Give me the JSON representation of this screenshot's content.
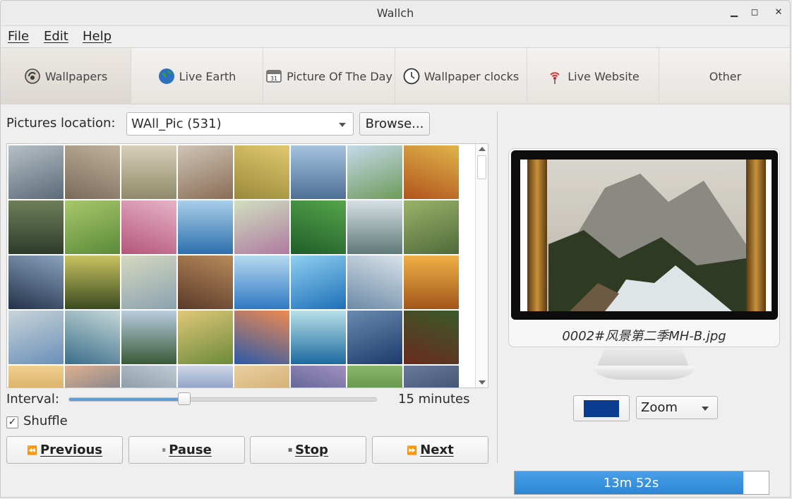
{
  "window": {
    "title": "Wallch"
  },
  "menu": [
    {
      "label": "File",
      "icon": "file"
    },
    {
      "label": "Edit",
      "icon": "edit"
    },
    {
      "label": "Help",
      "icon": "help"
    }
  ],
  "tabs": [
    {
      "label": "Wallpapers",
      "icon": "wallpapers-icon",
      "active": true
    },
    {
      "label": "Live Earth",
      "icon": "globe-icon",
      "active": false
    },
    {
      "label": "Picture Of The Day",
      "icon": "calendar-icon",
      "active": false
    },
    {
      "label": "Wallpaper clocks",
      "icon": "clock-icon",
      "active": false
    },
    {
      "label": "Live Website",
      "icon": "broadcast-icon",
      "active": false
    },
    {
      "label": "Other",
      "icon": "",
      "active": false
    }
  ],
  "location": {
    "label": "Pictures location:",
    "selected": "WAll_Pic (531)",
    "browse_label": "Browse..."
  },
  "thumbnails": [
    {
      "colors": [
        "#5a6a78",
        "#b7c0c5"
      ]
    },
    {
      "colors": [
        "#7a6a5a",
        "#c2b19a"
      ]
    },
    {
      "colors": [
        "#8f8a6a",
        "#d7d0b8"
      ]
    },
    {
      "colors": [
        "#8a6c55",
        "#cfc5b6"
      ]
    },
    {
      "colors": [
        "#9a8a3a",
        "#e0c870"
      ]
    },
    {
      "colors": [
        "#4d6f95",
        "#a6c3df"
      ]
    },
    {
      "colors": [
        "#6e9b5a",
        "#c4d9ea"
      ]
    },
    {
      "colors": [
        "#b1541d",
        "#e0b44a"
      ]
    },
    {
      "colors": [
        "#2e3a2a",
        "#6f7f5a"
      ]
    },
    {
      "colors": [
        "#5a8a3a",
        "#a8c86a"
      ]
    },
    {
      "colors": [
        "#b4567a",
        "#e7b3c7"
      ]
    },
    {
      "colors": [
        "#2e6fae",
        "#a9cfea"
      ]
    },
    {
      "colors": [
        "#b07aa0",
        "#cfe0c0"
      ]
    },
    {
      "colors": [
        "#1f5d2a",
        "#56a54a"
      ]
    },
    {
      "colors": [
        "#5f7a78",
        "#d6e0e4"
      ]
    },
    {
      "colors": [
        "#4f6a3a",
        "#9ab36a"
      ]
    },
    {
      "colors": [
        "#23324a",
        "#8aa3bd"
      ]
    },
    {
      "colors": [
        "#3a4a20",
        "#c9c360"
      ]
    },
    {
      "colors": [
        "#8aa2b0",
        "#d6d8c0"
      ]
    },
    {
      "colors": [
        "#5a3a2a",
        "#b78a5a"
      ]
    },
    {
      "colors": [
        "#2f79c2",
        "#b6d8f0"
      ]
    },
    {
      "colors": [
        "#1d6fb9",
        "#8fd0f0"
      ]
    },
    {
      "colors": [
        "#6c8aa6",
        "#d8e2ea"
      ]
    },
    {
      "colors": [
        "#a2561a",
        "#f0b046"
      ]
    },
    {
      "colors": [
        "#6a8fb8",
        "#c8d4d9"
      ]
    },
    {
      "colors": [
        "#3b6d8a",
        "#c5d8d8"
      ]
    },
    {
      "colors": [
        "#385a36",
        "#b8cde0"
      ]
    },
    {
      "colors": [
        "#6b8a3a",
        "#e0c878"
      ]
    },
    {
      "colors": [
        "#2a5aa8",
        "#f08a50"
      ]
    },
    {
      "colors": [
        "#1c6aa0",
        "#b8e0e8"
      ]
    },
    {
      "colors": [
        "#1d3a6a",
        "#6a8ab0"
      ]
    },
    {
      "colors": [
        "#6a2a20",
        "#3a5a2a"
      ]
    },
    {
      "colors": [
        "#c08a3a",
        "#f0d090"
      ]
    },
    {
      "colors": [
        "#4a6a8a",
        "#e0b090"
      ]
    },
    {
      "colors": [
        "#6a7a8a",
        "#c0ccd4"
      ]
    },
    {
      "colors": [
        "#3a5a9a",
        "#d0d8e8"
      ]
    },
    {
      "colors": [
        "#c89a5a",
        "#e8d0a0"
      ]
    },
    {
      "colors": [
        "#3a4a7a",
        "#a090c0"
      ]
    },
    {
      "colors": [
        "#3a6a2a",
        "#8ab86a"
      ]
    },
    {
      "colors": [
        "#2a3a5a",
        "#6a7a9a"
      ]
    }
  ],
  "interval": {
    "label": "Interval:",
    "value_text": "15 minutes",
    "fraction": 0.375
  },
  "shuffle": {
    "label": "Shuffle",
    "checked": true,
    "check_glyph": "✓"
  },
  "controls": {
    "previous": {
      "glyph": "⏪",
      "label": "Previous"
    },
    "pause": {
      "glyph": "⏸",
      "label": "Pause"
    },
    "stop": {
      "glyph": "⏹",
      "label": "Stop"
    },
    "next": {
      "glyph": "⏩",
      "label": "Next"
    }
  },
  "preview": {
    "filename": "0002#风景第二季MH-B.jpg"
  },
  "color": {
    "value": "#0a3d8f"
  },
  "mode": {
    "selected": "Zoom"
  },
  "timer": {
    "text": "13m 52s",
    "fraction": 0.9
  }
}
